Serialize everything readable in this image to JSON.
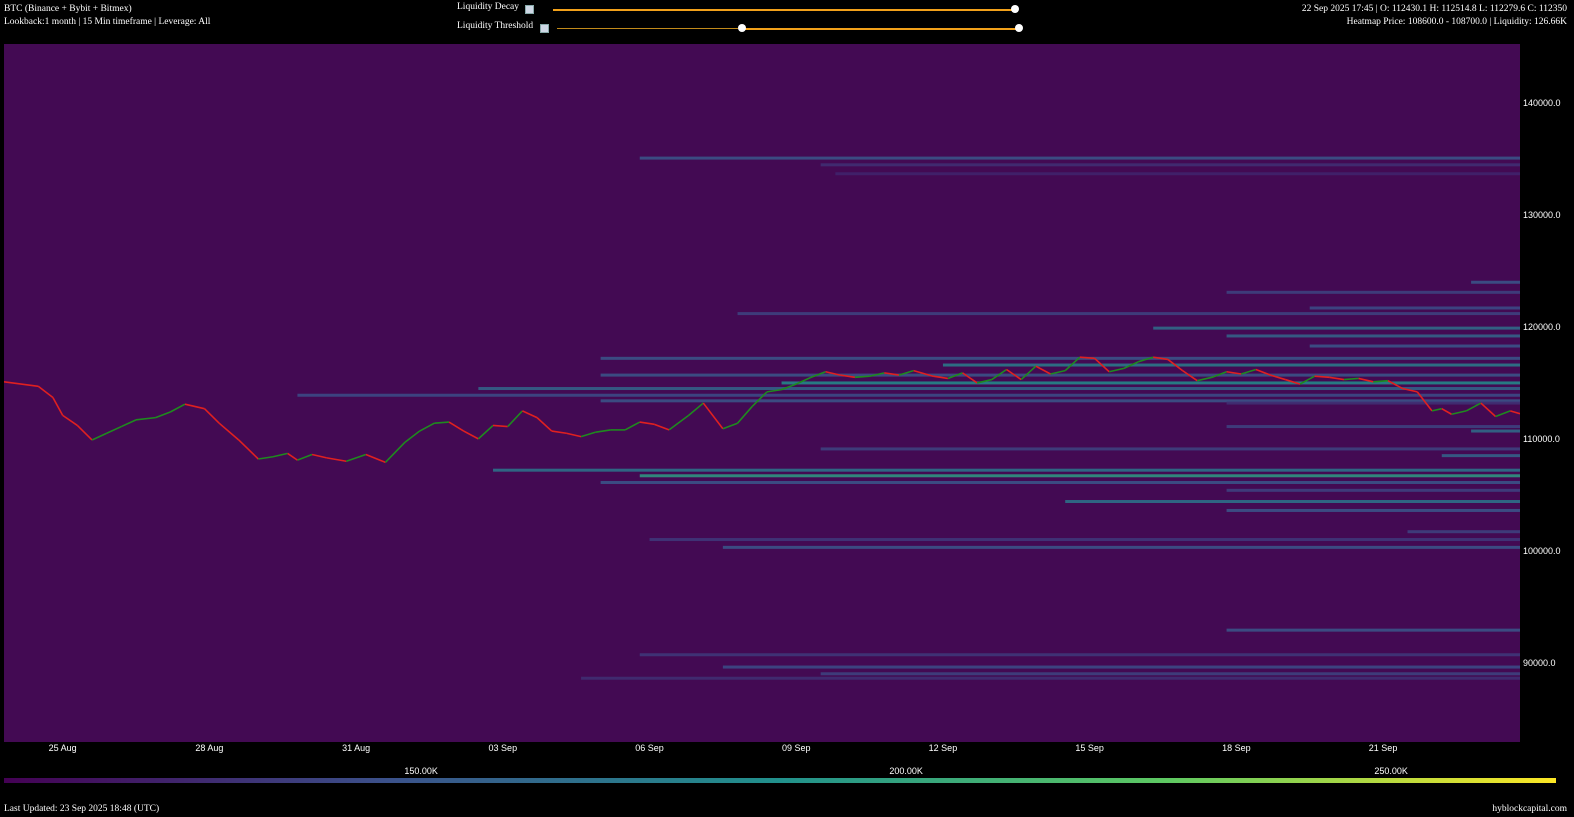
{
  "header": {
    "title": "BTC (Binance + Bybit + Bitmex)",
    "subtitle": "Lookback:1 month | 15 Min timeframe | Leverage: All",
    "ohlc": "22 Sep 2025 17:45 | O: 112430.1 H: 112514.8 L: 112279.6 C: 112350",
    "heatmap_info": "Heatmap Price: 108600.0 - 108700.0 | Liquidity: 126.66K"
  },
  "controls": {
    "decay": {
      "label": "Liquidity Decay",
      "value": 1.0
    },
    "threshold": {
      "label": "Liquidity Threshold",
      "low": 0.4,
      "high": 1.0
    }
  },
  "colorbar": {
    "labels": [
      "150.00K",
      "200.00K",
      "250.00K"
    ],
    "label_values": [
      150000,
      200000,
      250000
    ],
    "min": 107000,
    "max": 267000,
    "colors": [
      "#440154",
      "#3b528b",
      "#21918c",
      "#5ec962",
      "#fde725"
    ]
  },
  "footer": {
    "last_updated": "Last Updated: 23 Sep 2025 18:48 (UTC)",
    "site": "hyblockcapital.com"
  },
  "colors": {
    "background": "#000000",
    "heatmap_bg": "#430a53",
    "up": "#1f8a1f",
    "down": "#e02020",
    "slider": "#f2a11a"
  },
  "chart_data": {
    "type": "heatmap",
    "title": "",
    "xlabel": "",
    "ylabel": "",
    "x_tick_labels": [
      "25 Aug",
      "28 Aug",
      "31 Aug",
      "03 Sep",
      "06 Sep",
      "09 Sep",
      "12 Sep",
      "15 Sep",
      "18 Sep",
      "21 Sep"
    ],
    "x_tick_days": [
      1,
      4,
      7,
      10,
      13,
      16,
      19,
      22,
      25,
      28
    ],
    "x_range_days": [
      -0.2,
      30.8
    ],
    "y_ticks": [
      "140000.0",
      "130000.0",
      "120000.0",
      "110000.0",
      "100000.0",
      "90000.0"
    ],
    "y_tick_values": [
      140000,
      130000,
      120000,
      110000,
      100000,
      90000
    ],
    "ylim": [
      83000,
      145400
    ],
    "grid": false,
    "price_series": {
      "x_days": [
        -0.2,
        0.5,
        0.8,
        1.0,
        1.3,
        1.6,
        1.9,
        2.2,
        2.5,
        2.9,
        3.2,
        3.5,
        3.9,
        4.2,
        4.6,
        5.0,
        5.3,
        5.6,
        5.8,
        6.1,
        6.4,
        6.8,
        7.2,
        7.6,
        8.0,
        8.3,
        8.6,
        8.9,
        9.2,
        9.5,
        9.8,
        10.1,
        10.4,
        10.7,
        11.0,
        11.3,
        11.6,
        11.9,
        12.2,
        12.5,
        12.8,
        13.1,
        13.4,
        13.8,
        14.1,
        14.5,
        14.8,
        15.1,
        15.4,
        15.7,
        16.0,
        16.3,
        16.6,
        16.9,
        17.2,
        17.5,
        17.8,
        18.1,
        18.4,
        18.8,
        19.1,
        19.4,
        19.7,
        20.0,
        20.3,
        20.6,
        20.9,
        21.2,
        21.5,
        21.8,
        22.1,
        22.4,
        22.7,
        23.0,
        23.3,
        23.6,
        23.9,
        24.2,
        24.5,
        24.8,
        25.1,
        25.4,
        25.7,
        26.0,
        26.3,
        26.6,
        26.9,
        27.2,
        27.5,
        27.8,
        28.1,
        28.4,
        28.7,
        29.0,
        29.2,
        29.4,
        29.7,
        30.0,
        30.3,
        30.6,
        30.8
      ],
      "close": [
        115200,
        114800,
        113800,
        112200,
        111300,
        110000,
        110600,
        111200,
        111800,
        112000,
        112500,
        113200,
        112800,
        111500,
        110000,
        108300,
        108500,
        108800,
        108200,
        108700,
        108400,
        108100,
        108700,
        108000,
        109800,
        110800,
        111500,
        111600,
        110800,
        110100,
        111300,
        111200,
        112600,
        112000,
        110800,
        110600,
        110300,
        110700,
        110900,
        110900,
        111600,
        111400,
        110900,
        112200,
        113300,
        111000,
        111500,
        113000,
        114300,
        114500,
        115000,
        115600,
        116100,
        115800,
        115600,
        115700,
        116000,
        115800,
        116200,
        115700,
        115500,
        116000,
        115100,
        115400,
        116300,
        115400,
        116600,
        115900,
        116200,
        117400,
        117300,
        116100,
        116400,
        117000,
        117400,
        117200,
        116200,
        115300,
        115600,
        116100,
        115900,
        116300,
        115800,
        115400,
        115000,
        115700,
        115600,
        115400,
        115500,
        115200,
        115300,
        114600,
        114300,
        112600,
        112800,
        112300,
        112600,
        113300,
        112100,
        112600,
        112350
      ]
    },
    "liquidity_levels": [
      {
        "price": 135200,
        "start_day": 12.8,
        "liquidity": 150000
      },
      {
        "price": 134600,
        "start_day": 16.5,
        "liquidity": 130000
      },
      {
        "price": 133800,
        "start_day": 16.8,
        "liquidity": 125000
      },
      {
        "price": 124100,
        "start_day": 29.8,
        "liquidity": 150000
      },
      {
        "price": 123200,
        "start_day": 24.8,
        "liquidity": 140000
      },
      {
        "price": 121800,
        "start_day": 26.5,
        "liquidity": 145000
      },
      {
        "price": 121300,
        "start_day": 14.8,
        "liquidity": 140000
      },
      {
        "price": 120000,
        "start_day": 23.3,
        "liquidity": 165000
      },
      {
        "price": 119300,
        "start_day": 24.8,
        "liquidity": 160000
      },
      {
        "price": 118400,
        "start_day": 26.5,
        "liquidity": 150000
      },
      {
        "price": 117300,
        "start_day": 12.0,
        "liquidity": 150000
      },
      {
        "price": 116700,
        "start_day": 19.0,
        "liquidity": 175000
      },
      {
        "price": 115800,
        "start_day": 12.0,
        "liquidity": 150000
      },
      {
        "price": 115100,
        "start_day": 15.7,
        "liquidity": 185000
      },
      {
        "price": 114600,
        "start_day": 9.5,
        "liquidity": 160000
      },
      {
        "price": 114000,
        "start_day": 5.8,
        "liquidity": 145000
      },
      {
        "price": 113500,
        "start_day": 12.0,
        "liquidity": 150000
      },
      {
        "price": 113300,
        "start_day": 24.8,
        "liquidity": 130000
      },
      {
        "price": 111200,
        "start_day": 24.8,
        "liquidity": 140000
      },
      {
        "price": 110800,
        "start_day": 29.8,
        "liquidity": 165000
      },
      {
        "price": 109200,
        "start_day": 16.5,
        "liquidity": 140000
      },
      {
        "price": 108600,
        "start_day": 29.2,
        "liquidity": 160000
      },
      {
        "price": 107300,
        "start_day": 9.8,
        "liquidity": 170000
      },
      {
        "price": 106800,
        "start_day": 12.8,
        "liquidity": 195000
      },
      {
        "price": 106200,
        "start_day": 12.0,
        "liquidity": 150000
      },
      {
        "price": 105500,
        "start_day": 24.8,
        "liquidity": 140000
      },
      {
        "price": 104500,
        "start_day": 21.5,
        "liquidity": 170000
      },
      {
        "price": 103700,
        "start_day": 24.8,
        "liquidity": 150000
      },
      {
        "price": 101800,
        "start_day": 28.5,
        "liquidity": 140000
      },
      {
        "price": 101100,
        "start_day": 13.0,
        "liquidity": 135000
      },
      {
        "price": 100400,
        "start_day": 14.5,
        "liquidity": 150000
      },
      {
        "price": 93000,
        "start_day": 24.8,
        "liquidity": 150000
      },
      {
        "price": 90800,
        "start_day": 12.8,
        "liquidity": 135000
      },
      {
        "price": 89700,
        "start_day": 14.5,
        "liquidity": 145000
      },
      {
        "price": 89100,
        "start_day": 16.5,
        "liquidity": 140000
      },
      {
        "price": 88700,
        "start_day": 11.6,
        "liquidity": 130000
      }
    ]
  }
}
